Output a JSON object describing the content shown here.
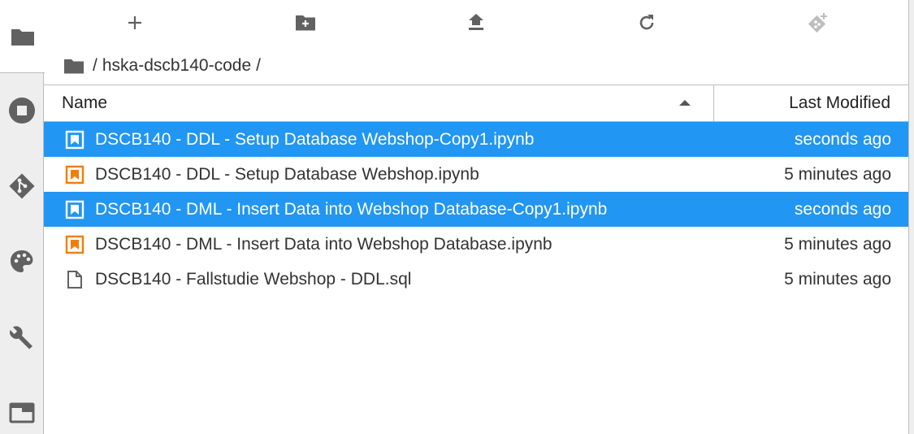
{
  "colors": {
    "selection": "#2196f3",
    "notebook_icon": "#f57c00",
    "sidebar_bg": "#eeeeee",
    "icon": "#616161"
  },
  "sidebar": {
    "tabs": [
      {
        "name": "file-browser",
        "icon": "folder-icon",
        "active": true
      },
      {
        "name": "running",
        "icon": "stop-circle-icon",
        "active": false
      },
      {
        "name": "git",
        "icon": "git-icon",
        "active": false
      },
      {
        "name": "commands",
        "icon": "palette-icon",
        "active": false
      },
      {
        "name": "extensions",
        "icon": "wrench-icon",
        "active": false
      },
      {
        "name": "tabs",
        "icon": "tab-icon",
        "active": false
      }
    ]
  },
  "toolbar": {
    "buttons": [
      {
        "icon": "plus-icon"
      },
      {
        "icon": "new-folder-icon"
      },
      {
        "icon": "upload-icon"
      },
      {
        "icon": "refresh-icon"
      },
      {
        "icon": "git-clone-icon",
        "disabled": true
      }
    ]
  },
  "breadcrumbs": {
    "separator": "/",
    "path": "hska-dscb140-code",
    "trailing": "/"
  },
  "listing": {
    "header": {
      "name_label": "Name",
      "modified_label": "Last Modified",
      "sort": "ascending"
    },
    "files": [
      {
        "name": "DSCB140 - DDL - Setup Database Webshop-Copy1.ipynb",
        "modified": "seconds ago",
        "type": "notebook",
        "selected": true
      },
      {
        "name": "DSCB140 - DDL - Setup Database Webshop.ipynb",
        "modified": "5 minutes ago",
        "type": "notebook",
        "selected": false
      },
      {
        "name": "DSCB140 - DML - Insert Data into Webshop Database-Copy1.ipynb",
        "modified": "seconds ago",
        "type": "notebook",
        "selected": true
      },
      {
        "name": "DSCB140 - DML - Insert Data into Webshop Database.ipynb",
        "modified": "5 minutes ago",
        "type": "notebook",
        "selected": false
      },
      {
        "name": "DSCB140 - Fallstudie Webshop - DDL.sql",
        "modified": "5 minutes ago",
        "type": "file",
        "selected": false
      }
    ]
  }
}
